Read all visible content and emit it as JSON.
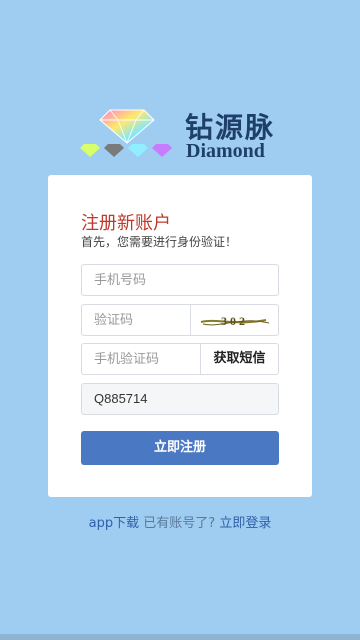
{
  "brand": {
    "name_cn": "钻源脉",
    "name_en": "Diamond"
  },
  "card": {
    "title": "注册新账户",
    "subtitle": "首先，您需要进行身份验证！"
  },
  "form": {
    "phone_placeholder": "手机号码",
    "captcha_placeholder": "验证码",
    "captcha_text": "3 0 2",
    "sms_placeholder": "手机验证码",
    "sms_button_label": "获取短信",
    "invite_code_value": "Q885714",
    "submit_label": "立即注册"
  },
  "footer": {
    "app_download": "app下载",
    "has_account": "已有账号了?",
    "login_link": "立即登录"
  },
  "colors": {
    "background": "#9fcdf2",
    "accent": "#4a78c2",
    "title": "#c0392b",
    "brand": "#1f3f6b"
  }
}
